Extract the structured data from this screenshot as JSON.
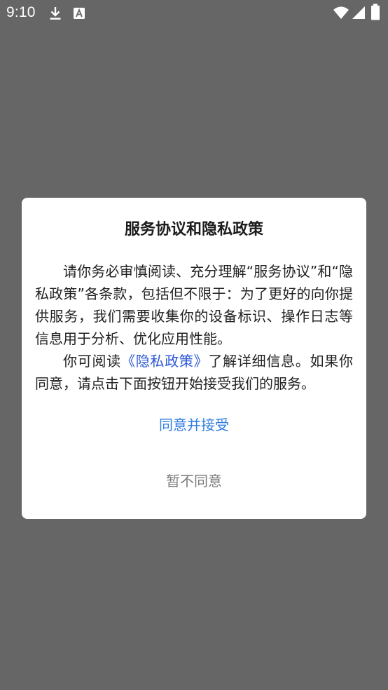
{
  "status_bar": {
    "time": "9:10",
    "icons": [
      "download-icon",
      "a-badge-icon",
      "wifi-icon",
      "signal-icon",
      "battery-icon"
    ]
  },
  "dialog": {
    "title": "服务协议和隐私政策",
    "paragraph1": "请你务必审慎阅读、充分理解“服务协议”和“隐私政策”各条款，包括但不限于：为了更好的向你提供服务，我们需要收集你的设备标识、操作日志等信息用于分析、优化应用性能。",
    "paragraph2_prefix": "你可阅读",
    "paragraph2_link": "《隐私政策》",
    "paragraph2_suffix": "了解详细信息。如果你同意，请点击下面按钮开始接受我们的服务。",
    "agree_label": "同意并接受",
    "decline_label": "暂不同意"
  },
  "colors": {
    "backdrop": "#666666",
    "dialog_bg": "#ffffff",
    "link": "#2a57d6",
    "agree": "#2e7ce0",
    "decline": "#7a7a7a"
  }
}
